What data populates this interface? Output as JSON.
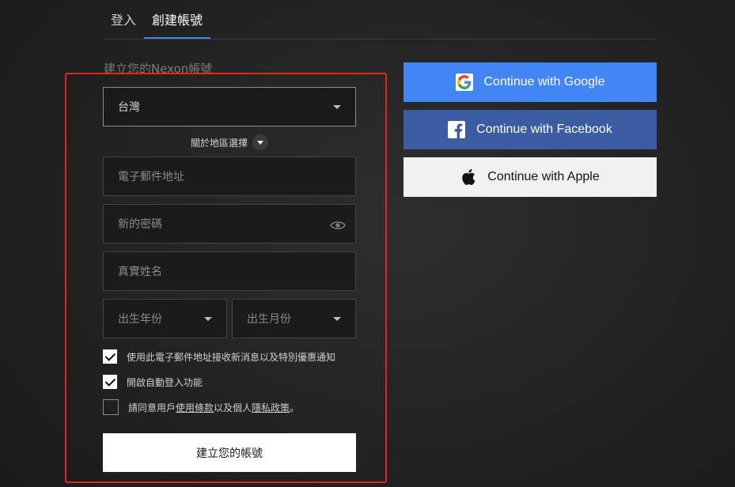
{
  "tabs": [
    {
      "label": "登入",
      "active": false
    },
    {
      "label": "創建帳號",
      "active": true
    }
  ],
  "form": {
    "title": "建立您的Nexon帳號",
    "region": {
      "value": "台灣"
    },
    "region_about": "關於地區選擇",
    "email": {
      "placeholder": "電子郵件地址"
    },
    "password": {
      "placeholder": "新的密碼"
    },
    "real_name": {
      "placeholder": "真實姓名"
    },
    "birth_year": {
      "placeholder": "出生年份"
    },
    "birth_month": {
      "placeholder": "出生月份"
    },
    "checkboxes": [
      {
        "label": "使用此電子郵件地址接收新消息以及特別優惠通知",
        "checked": true
      },
      {
        "label": "開啟自動登入功能",
        "checked": true
      }
    ],
    "terms": {
      "checked": false,
      "prefix": "請同意用戶",
      "terms_link": "使用條款",
      "middle": "以及個人",
      "privacy_link": "隱私政策",
      "suffix": "。"
    },
    "submit_label": "建立您的帳號"
  },
  "social": {
    "google": "Continue with Google",
    "facebook": "Continue with Facebook",
    "apple": "Continue with Apple"
  },
  "colors": {
    "accent_tab": "#3b82f6",
    "highlight": "#e0271e",
    "google": "#4285f4",
    "facebook": "#3b5ba2",
    "apple": "#f0f0f0"
  }
}
